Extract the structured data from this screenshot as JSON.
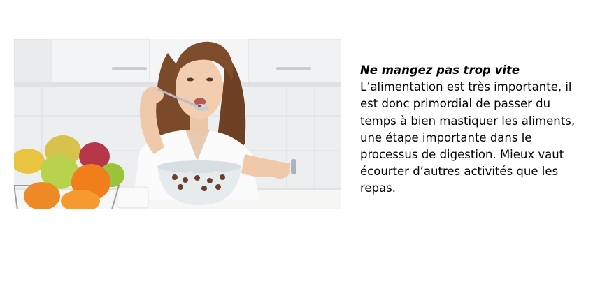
{
  "article": {
    "heading": "Ne mangez pas trop vite",
    "body": "L’alimentation est très importante, il est donc primordial de passer du temps à bien mastiquer les aliments, une étape importante dans le processus de digestion. Mieux vaut écourter d’autres activités que les repas."
  },
  "photo": {
    "subject": "woman-eating-cereal-checking-watch"
  }
}
